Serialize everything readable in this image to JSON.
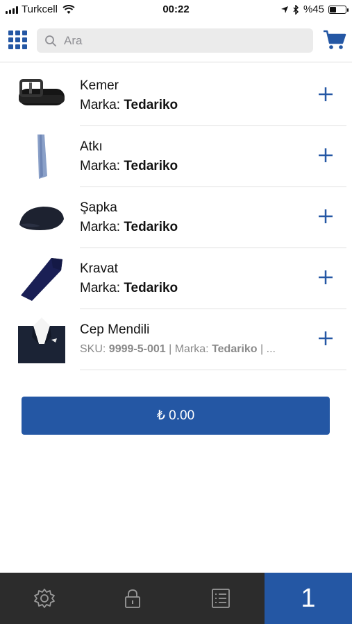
{
  "status_bar": {
    "carrier": "Turkcell",
    "time": "00:22",
    "battery": "%45",
    "battery_level": 0.45
  },
  "header": {
    "search_placeholder": "Ara",
    "menu_icon": "grid-icon",
    "cart_icon": "cart-icon"
  },
  "products": [
    {
      "name": "Kemer",
      "brand_label": "Marka:",
      "brand": "Tedariko",
      "thumb": "belt"
    },
    {
      "name": "Atkı",
      "brand_label": "Marka:",
      "brand": "Tedariko",
      "thumb": "scarf"
    },
    {
      "name": "Şapka",
      "brand_label": "Marka:",
      "brand": "Tedariko",
      "thumb": "cap"
    },
    {
      "name": "Kravat",
      "brand_label": "Marka:",
      "brand": "Tedariko",
      "thumb": "tie"
    },
    {
      "name": "Cep Mendili",
      "sku_label": "SKU:",
      "sku": "9999-5-001",
      "sep": "|",
      "brand_label": "Marka:",
      "brand": "Tedariko",
      "trail": "| ...",
      "thumb": "suit"
    }
  ],
  "total": "₺ 0.00",
  "tabbar": {
    "settings_icon": "gear-icon",
    "lock_icon": "lock-icon",
    "list_icon": "list-icon",
    "cart_count": "1"
  },
  "colors": {
    "accent": "#2457a4",
    "tabbar_bg": "#2c2c2c"
  }
}
